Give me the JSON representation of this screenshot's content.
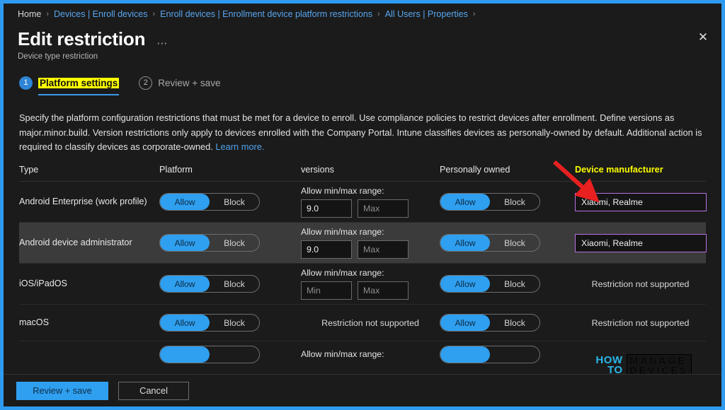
{
  "breadcrumb": {
    "separator": "›",
    "items": [
      {
        "label": "Home",
        "kind": "home"
      },
      {
        "label": "Devices | Enroll devices",
        "kind": "link"
      },
      {
        "label": "Enroll devices | Enrollment device platform restrictions",
        "kind": "link"
      },
      {
        "label": "All Users | Properties",
        "kind": "link"
      }
    ]
  },
  "header": {
    "title": "Edit restriction",
    "subtitle": "Device type restriction",
    "more_label": "⋯",
    "close_label": "✕"
  },
  "tabs": [
    {
      "number": "1",
      "label": "Platform settings",
      "state": "active"
    },
    {
      "number": "2",
      "label": "Review + save",
      "state": "inactive"
    }
  ],
  "description": {
    "text": "Specify the platform configuration restrictions that must be met for a device to enroll. Use compliance policies to restrict devices after enrollment. Define versions as major.minor.build. Version restrictions only apply to devices enrolled with the Company Portal. Intune classifies devices as personally-owned by default. Additional action is required to classify devices as corporate-owned. ",
    "link_label": "Learn more."
  },
  "table": {
    "headers": {
      "type": "Type",
      "platform": "Platform",
      "versions": "versions",
      "personally_owned": "Personally owned",
      "device_manufacturer": "Device manufacturer"
    },
    "toggle_labels": {
      "allow": "Allow",
      "block": "Block"
    },
    "version_label": "Allow min/max range:",
    "placeholders": {
      "min": "Min",
      "max": "Max"
    },
    "not_supported": "Restriction not supported",
    "rows": [
      {
        "type": "Android Enterprise (work profile)",
        "platform_state": "Allow",
        "versions_kind": "range",
        "version_min": "9.0",
        "version_max": "",
        "personally_owned_state": "Allow",
        "manufacturer_kind": "input",
        "manufacturer_value": "Xiaomi, Realme",
        "hovered": false
      },
      {
        "type": "Android device administrator",
        "platform_state": "Allow",
        "versions_kind": "range",
        "version_min": "9.0",
        "version_max": "",
        "personally_owned_state": "Allow",
        "manufacturer_kind": "input",
        "manufacturer_value": "Xiaomi, Realme",
        "hovered": true
      },
      {
        "type": "iOS/iPadOS",
        "platform_state": "Allow",
        "versions_kind": "range",
        "version_min": "",
        "version_max": "",
        "personally_owned_state": "Allow",
        "manufacturer_kind": "text",
        "manufacturer_value": "Restriction not supported",
        "hovered": false
      },
      {
        "type": "macOS",
        "platform_state": "Allow",
        "versions_kind": "text",
        "versions_text": "Restriction not supported",
        "personally_owned_state": "Allow",
        "manufacturer_kind": "text",
        "manufacturer_value": "Restriction not supported",
        "hovered": false
      }
    ],
    "partial_row": {
      "versions_label": "Allow min/max range:"
    }
  },
  "footer": {
    "review_save_label": "Review + save",
    "cancel_label": "Cancel"
  },
  "watermark": {
    "how": "HOW",
    "to": "TO",
    "manage": "MANAGE",
    "devices": "DEVICES"
  },
  "annotation": {
    "arrow_color": "#e8201f"
  }
}
